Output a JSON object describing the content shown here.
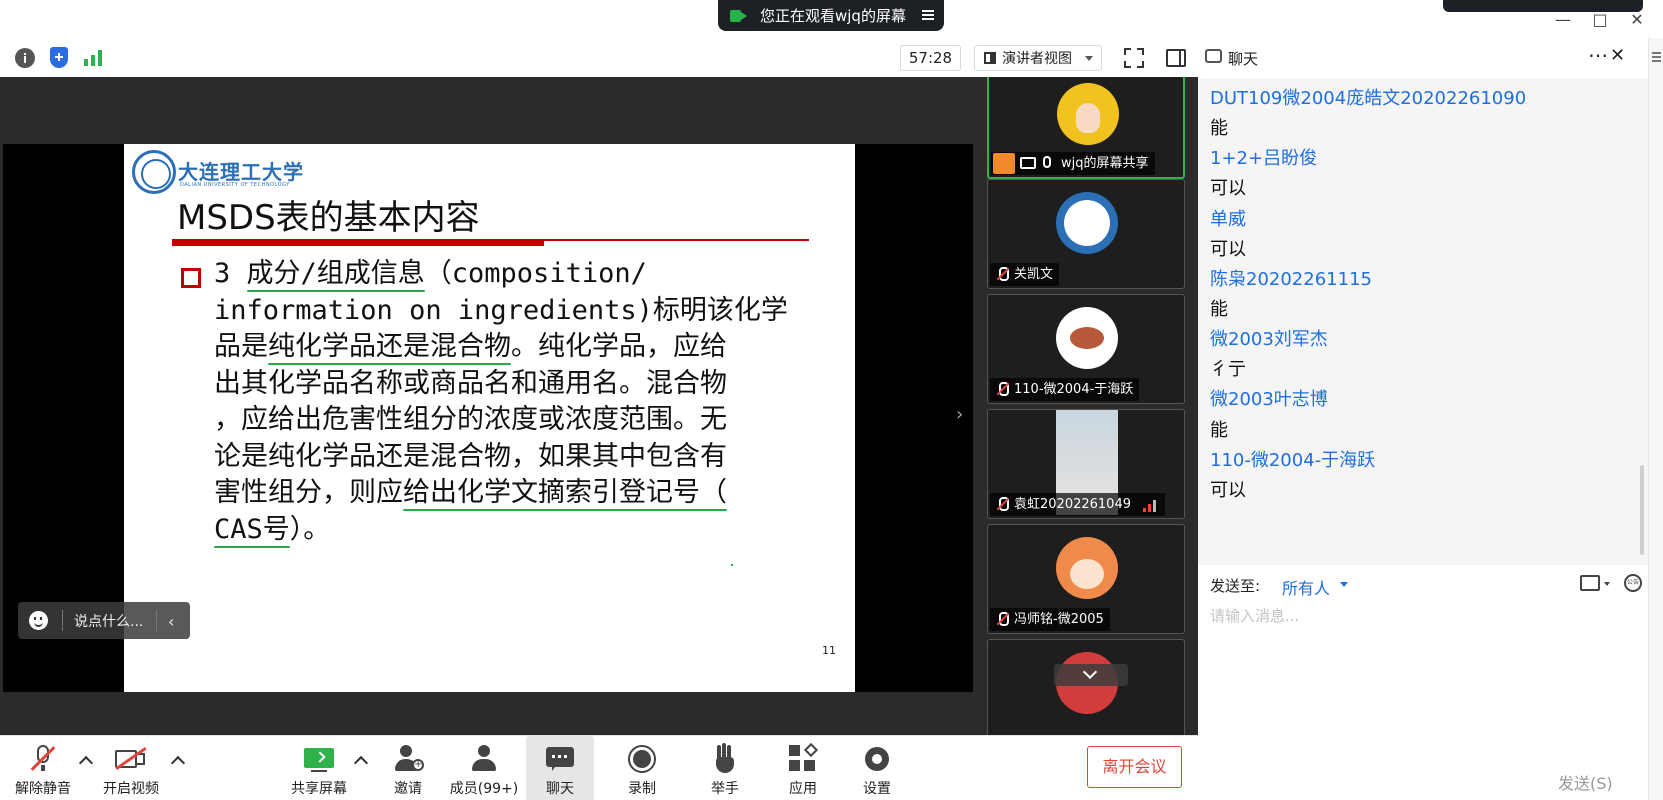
{
  "window": {
    "share_banner": "您正在观看wjq的屏幕"
  },
  "toolbar": {
    "timer": "57:28",
    "view_mode": "演讲者视图"
  },
  "slide": {
    "university": "大连理工大学",
    "university_en": "DALIAN UNIVERSITY OF TECHNOLOGY",
    "title": "MSDS表的基本内容",
    "body_lines": [
      [
        "3 ",
        "成分/组成信息",
        "（composition/"
      ],
      [
        "information on ingredients)标明该化学"
      ],
      [
        "品是",
        "纯化学品还是混合物",
        "。纯化学品，应给"
      ],
      [
        "出其化学品名称或商品名和通用名。混合物"
      ],
      [
        "，应给出危害性组分的浓度或浓度范围。无"
      ],
      [
        "论是纯化学品还是混合物，如果其中包含有"
      ],
      [
        "害性组分，则应",
        "给出化学文摘索引登记号（"
      ],
      [
        "CAS号",
        "）。"
      ]
    ],
    "page_number": "11"
  },
  "reaction_bar": {
    "placeholder": "说点什么..."
  },
  "participants": [
    {
      "name": "wjq的屏幕共享",
      "avatar_color": "#f2c31f",
      "sharing": true
    },
    {
      "name": "关凯文",
      "avatar_color": "#2b6fb6"
    },
    {
      "name": "110-微2004-于海跃",
      "avatar_color": "#ffffff"
    },
    {
      "name": "袁虹20202261049",
      "avatar_color": "#c9d6df"
    },
    {
      "name": "冯师铭-微2005",
      "avatar_color": "#f08a4b"
    },
    {
      "name": "",
      "avatar_color": "#d23c3c"
    }
  ],
  "chat": {
    "title": "聊天",
    "messages": [
      {
        "type": "name",
        "text": "DUT109微2004庞皓文20202261090"
      },
      {
        "type": "msg",
        "text": "能"
      },
      {
        "type": "name",
        "text": "1+2+吕盼俊"
      },
      {
        "type": "msg",
        "text": "可以"
      },
      {
        "type": "name",
        "text": "单威"
      },
      {
        "type": "msg",
        "text": "可以"
      },
      {
        "type": "name",
        "text": "陈枭20202261115"
      },
      {
        "type": "msg",
        "text": "能"
      },
      {
        "type": "name",
        "text": "微2003刘军杰"
      },
      {
        "type": "msg",
        "text": "彳亍"
      },
      {
        "type": "name",
        "text": "微2003叶志博"
      },
      {
        "type": "msg",
        "text": "能"
      },
      {
        "type": "name",
        "text": "110-微2004-于海跃"
      },
      {
        "type": "msg",
        "text": "可以"
      }
    ],
    "send_to_label": "发送至:",
    "send_to_value": "所有人",
    "input_placeholder": "请输入消息...",
    "send_button": "发送(S)",
    "notice_icon_label": "公告"
  },
  "bottom": {
    "unmute": "解除静音",
    "start_video": "开启视频",
    "share_screen": "共享屏幕",
    "invite": "邀请",
    "members": "成员(99+)",
    "chat": "聊天",
    "record": "录制",
    "raise_hand": "举手",
    "apps": "应用",
    "settings": "设置",
    "leave": "离开会议"
  },
  "colors": {
    "accent_blue": "#1f6fe0",
    "danger_red": "#e0443d",
    "active_green": "#2fb24c",
    "slide_red": "#c00000"
  }
}
